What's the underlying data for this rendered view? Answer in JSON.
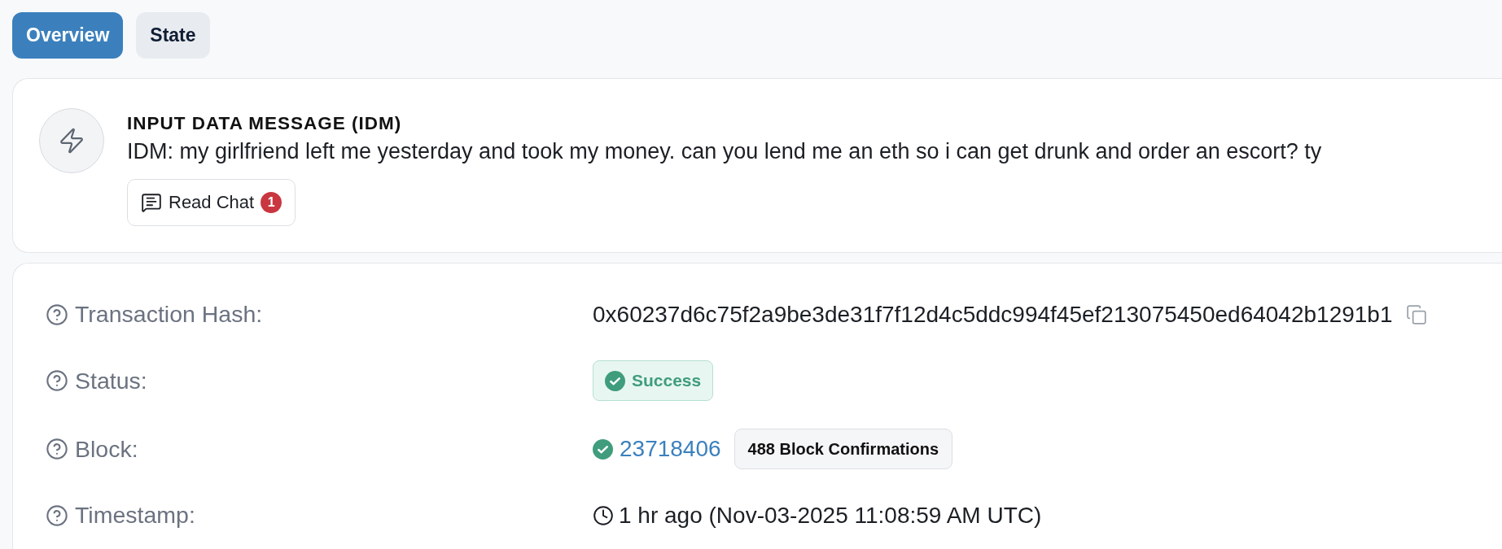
{
  "tabs": [
    {
      "label": "Overview",
      "selected": true
    },
    {
      "label": "State",
      "selected": false
    }
  ],
  "message_card": {
    "title": "INPUT DATA MESSAGE (IDM)",
    "message": "IDM: my girlfriend left me yesterday and took my money. can you lend me an eth so i can get drunk and order an escort? ty",
    "read_chat": {
      "label": "Read Chat",
      "count": "1"
    }
  },
  "details": [
    {
      "kind": "hash",
      "label": "Transaction Hash:",
      "value": "0x60237d6c75f2a9be3de31f7f12d4c5ddc994f45ef213075450ed64042b1291b1"
    },
    {
      "kind": "status",
      "label": "Status:",
      "value": "Success"
    },
    {
      "kind": "block",
      "label": "Block:",
      "value": "23718406",
      "confirmations": "488 Block Confirmations"
    },
    {
      "kind": "timestamp",
      "label": "Timestamp:",
      "value": "1 hr ago (Nov-03-2025 11:08:59 AM UTC)"
    }
  ]
}
